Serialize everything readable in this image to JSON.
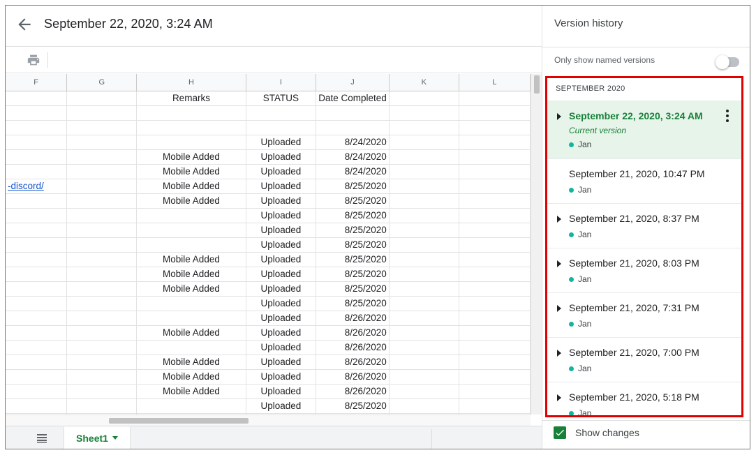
{
  "header": {
    "title": "September 22, 2020, 3:24 AM"
  },
  "grid": {
    "columns": [
      "F",
      "G",
      "H",
      "I",
      "J",
      "K",
      "L"
    ],
    "header_row": {
      "F": "",
      "G": "",
      "H": "Remarks",
      "I": "STATUS",
      "J": "Date Completed"
    },
    "rows": [
      {
        "F": "",
        "H": "",
        "I": "",
        "J": ""
      },
      {
        "F": "",
        "H": "",
        "I": "",
        "J": ""
      },
      {
        "F": "",
        "H": "",
        "I": "Uploaded",
        "J": "8/24/2020"
      },
      {
        "F": "",
        "H": "Mobile Added",
        "I": "Uploaded",
        "J": "8/24/2020"
      },
      {
        "F": "",
        "H": "Mobile Added",
        "I": "Uploaded",
        "J": "8/24/2020"
      },
      {
        "F": "-discord/",
        "H": "Mobile Added",
        "I": "Uploaded",
        "J": "8/25/2020"
      },
      {
        "F": "",
        "H": "Mobile Added",
        "I": "Uploaded",
        "J": "8/25/2020"
      },
      {
        "F": "",
        "H": "",
        "I": "Uploaded",
        "J": "8/25/2020"
      },
      {
        "F": "",
        "H": "",
        "I": "Uploaded",
        "J": "8/25/2020"
      },
      {
        "F": "",
        "H": "",
        "I": "Uploaded",
        "J": "8/25/2020"
      },
      {
        "F": "",
        "H": "Mobile Added",
        "I": "Uploaded",
        "J": "8/25/2020"
      },
      {
        "F": "",
        "H": "Mobile Added",
        "I": "Uploaded",
        "J": "8/25/2020"
      },
      {
        "F": "",
        "H": "Mobile Added",
        "I": "Uploaded",
        "J": "8/25/2020"
      },
      {
        "F": "",
        "H": "",
        "I": "Uploaded",
        "J": "8/25/2020"
      },
      {
        "F": "",
        "H": "",
        "I": "Uploaded",
        "J": "8/26/2020"
      },
      {
        "F": "",
        "H": "Mobile Added",
        "I": "Uploaded",
        "J": "8/26/2020"
      },
      {
        "F": "",
        "H": "",
        "I": "Uploaded",
        "J": "8/26/2020"
      },
      {
        "F": "",
        "H": "Mobile Added",
        "I": "Uploaded",
        "J": "8/26/2020"
      },
      {
        "F": "",
        "H": "Mobile Added",
        "I": "Uploaded",
        "J": "8/26/2020"
      },
      {
        "F": "",
        "H": "Mobile Added",
        "I": "Uploaded",
        "J": "8/26/2020"
      },
      {
        "F": "",
        "H": "",
        "I": "Uploaded",
        "J": "8/25/2020"
      },
      {
        "F": "",
        "H": "",
        "I": "",
        "J": ""
      }
    ]
  },
  "sheets": {
    "active": "Sheet1"
  },
  "panel": {
    "title": "Version history",
    "named_toggle_label": "Only show named versions",
    "named_toggle_on": false,
    "month_header": "SEPTEMBER 2020",
    "versions": [
      {
        "title": "September 22, 2020, 3:24 AM",
        "subtitle": "Current version",
        "author": "Jan",
        "expandable": true,
        "current": true
      },
      {
        "title": "September 21, 2020, 10:47 PM",
        "author": "Jan",
        "expandable": false
      },
      {
        "title": "September 21, 2020, 8:37 PM",
        "author": "Jan",
        "expandable": true
      },
      {
        "title": "September 21, 2020, 8:03 PM",
        "author": "Jan",
        "expandable": true
      },
      {
        "title": "September 21, 2020, 7:31 PM",
        "author": "Jan",
        "expandable": true
      },
      {
        "title": "September 21, 2020, 7:00 PM",
        "author": "Jan",
        "expandable": true
      },
      {
        "title": "September 21, 2020, 5:18 PM",
        "author": "Jan",
        "expandable": true
      }
    ],
    "show_changes_label": "Show changes",
    "show_changes_checked": true
  },
  "colors": {
    "accent": "#188038",
    "highlight_box": "#e00000",
    "author_dot": "#12b5a0",
    "current_bg": "#e6f4ea"
  },
  "icons": {
    "back": "arrow-back-icon",
    "print": "print-icon",
    "sheets_menu": "all-sheets-icon",
    "more": "more-vert-icon"
  }
}
